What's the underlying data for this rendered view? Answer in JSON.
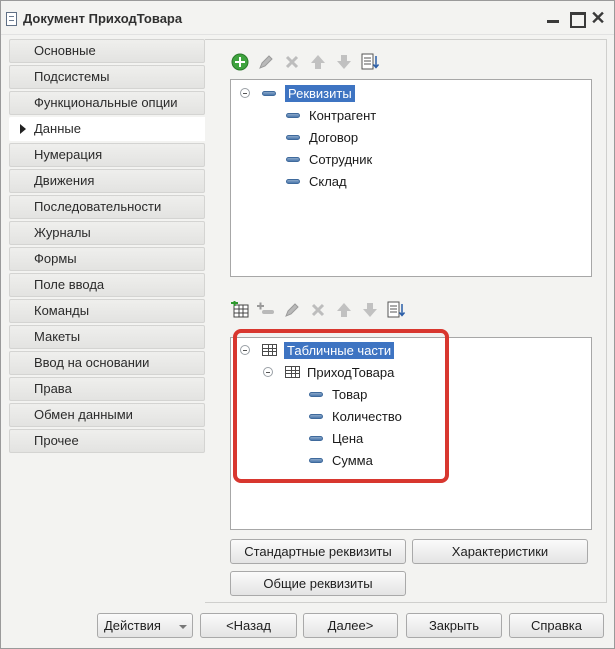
{
  "window": {
    "title": "Документ ПриходТовара",
    "close_glyph": "✕"
  },
  "nav": {
    "items": [
      {
        "label": "Основные"
      },
      {
        "label": "Подсистемы"
      },
      {
        "label": "Функциональные опции"
      },
      {
        "label": "Данные",
        "active": true
      },
      {
        "label": "Нумерация"
      },
      {
        "label": "Движения"
      },
      {
        "label": "Последовательности"
      },
      {
        "label": "Журналы"
      },
      {
        "label": "Формы"
      },
      {
        "label": "Поле ввода"
      },
      {
        "label": "Команды"
      },
      {
        "label": "Макеты"
      },
      {
        "label": "Ввод на основании"
      },
      {
        "label": "Права"
      },
      {
        "label": "Обмен данными"
      },
      {
        "label": "Прочее"
      }
    ]
  },
  "attributes_tree": {
    "root_label": "Реквизиты",
    "items": [
      "Контрагент",
      "Договор",
      "Сотрудник",
      "Склад"
    ]
  },
  "tabular_tree": {
    "root_label": "Табличные части",
    "table_label": "ПриходТовара",
    "items": [
      "Товар",
      "Количество",
      "Цена",
      "Сумма"
    ]
  },
  "panel_buttons": {
    "standard_attributes": "Стандартные реквизиты",
    "characteristics": "Характеристики",
    "common_attributes": "Общие реквизиты"
  },
  "footer": {
    "actions": "Действия",
    "back": "<Назад",
    "next": "Далее>",
    "close": "Закрыть",
    "help": "Справка"
  },
  "colors": {
    "selection": "#3e74c2",
    "highlight_frame": "#d8372f"
  }
}
